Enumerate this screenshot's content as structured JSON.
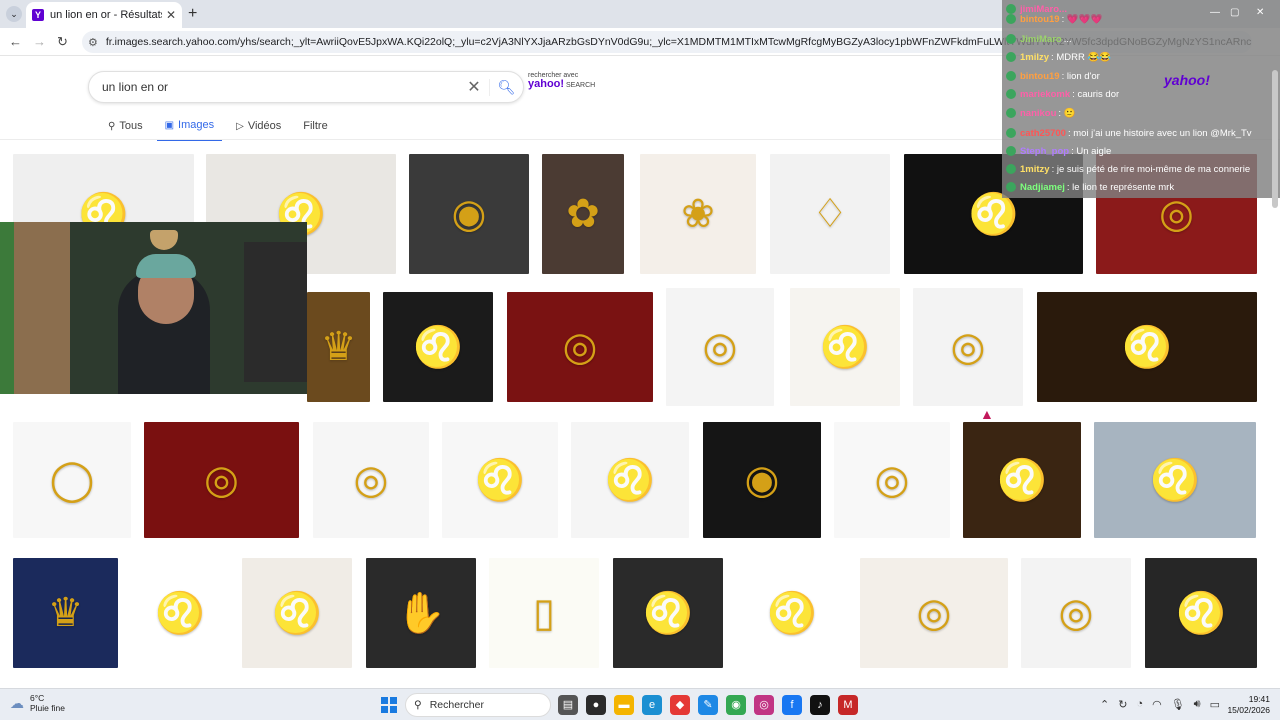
{
  "browser": {
    "tab_title": "un lion en or - Résultats Yahoo",
    "url": "fr.images.search.yahoo.com/yhs/search;_ylt=AwriiQovE5JpxWA.KQi22olQ;_ylu=c2VjA3NlYXJjaARzbGsDYnV0dG9u;_ylc=X1MDMTM1MTIxMTcwMgRfcgMyBGZyA3locy1pbWFnZWFkdmFuLWltYWdlYWR2YW5fc3dpdGNoBGZyMgNzYS1ncARncHJpZANSMldpLG06c2ltd..."
  },
  "search": {
    "query": "un lion en or",
    "powered_line1": "rechercher avec",
    "powered_brand": "yahoo!",
    "powered_suffix": "SEARCH"
  },
  "tabs": [
    {
      "label": "Tous",
      "icon": "search-icon"
    },
    {
      "label": "Images",
      "icon": "image-icon"
    },
    {
      "label": "Vidéos",
      "icon": "play-icon"
    },
    {
      "label": "Filtre",
      "icon": ""
    }
  ],
  "chat": {
    "messages": [
      {
        "user": "jimiMaro...",
        "text": ""
      },
      {
        "user": "bintou19",
        "text": ": 💗💗💗"
      },
      {
        "user": "JimiMaro",
        "text": "..."
      },
      {
        "user": "1milzy",
        "text": ": MDRR 😂😂"
      },
      {
        "user": "bintou19",
        "text": ": lion d'or"
      },
      {
        "user": "mariekomk",
        "text": ": cauris dor"
      },
      {
        "user": "nanikou",
        "text": ": 🙂"
      },
      {
        "user": "cath25700",
        "text": ": moi j'ai une histoire avec un lion @Mrk_Tv"
      },
      {
        "user": "Steph_pop",
        "text": ": Un aigle"
      },
      {
        "user": "1mitzy",
        "text": ": je suis pété de rire moi-même de ma connerie"
      },
      {
        "user": "Nadjiamej",
        "text": ": le lion te représente mrk"
      }
    ],
    "overlay_brand": "yahoo!"
  },
  "taskbar": {
    "temperature": "6°C",
    "weather": "Pluie fine",
    "search_placeholder": "Rechercher",
    "time": "19:41",
    "date": "15/02/2026"
  }
}
